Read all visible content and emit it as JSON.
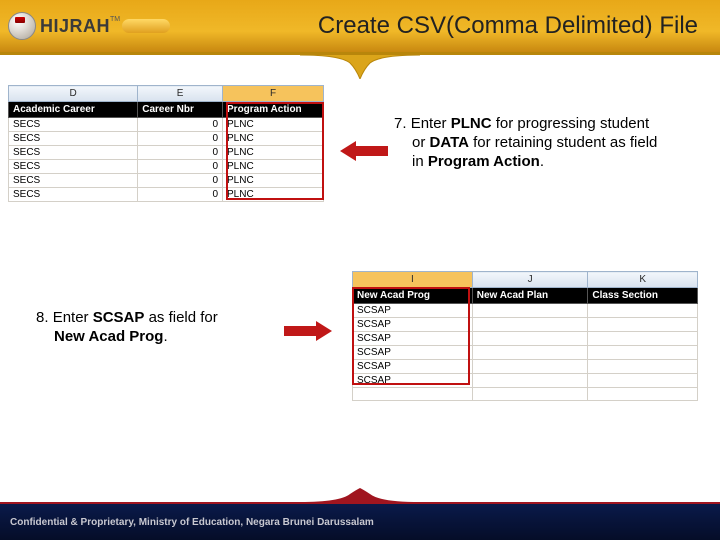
{
  "brand": {
    "name": "HIJRAH",
    "tm": "TM"
  },
  "title": "Create CSV(Comma Delimited) File",
  "table1": {
    "cols": {
      "d": "D",
      "e": "E",
      "f": "F"
    },
    "fields": {
      "career": "Academic Career",
      "nbr": "Career Nbr",
      "action": "Program Action"
    },
    "rows": [
      {
        "career": "SECS",
        "nbr": "0",
        "action": "PLNC"
      },
      {
        "career": "SECS",
        "nbr": "0",
        "action": "PLNC"
      },
      {
        "career": "SECS",
        "nbr": "0",
        "action": "PLNC"
      },
      {
        "career": "SECS",
        "nbr": "0",
        "action": "PLNC"
      },
      {
        "career": "SECS",
        "nbr": "0",
        "action": "PLNC"
      },
      {
        "career": "SECS",
        "nbr": "0",
        "action": "PLNC"
      }
    ]
  },
  "table2": {
    "cols": {
      "i": "I",
      "j": "J",
      "k": "K"
    },
    "fields": {
      "prog": "New Acad Prog",
      "plan": "New Acad Plan",
      "section": "Class Section"
    },
    "rows": [
      {
        "prog": "SCSAP",
        "plan": "",
        "section": ""
      },
      {
        "prog": "SCSAP",
        "plan": "",
        "section": ""
      },
      {
        "prog": "SCSAP",
        "plan": "",
        "section": ""
      },
      {
        "prog": "SCSAP",
        "plan": "",
        "section": ""
      },
      {
        "prog": "SCSAP",
        "plan": "",
        "section": ""
      },
      {
        "prog": "SCSAP",
        "plan": "",
        "section": ""
      }
    ]
  },
  "instr7": {
    "num": "7. ",
    "p1a": "Enter ",
    "p1b": "PLNC",
    "p1c": " for progressing student",
    "p2a": "or ",
    "p2b": "DATA",
    "p2c": " for retaining student as field",
    "p3a": "in ",
    "p3b": "Program Action",
    "p3c": "."
  },
  "instr8": {
    "num": "8. ",
    "p1a": "Enter ",
    "p1b": "SCSAP",
    "p1c": " as field for",
    "p2a": "",
    "p2b": "New Acad Prog",
    "p2c": "."
  },
  "footer": "Confidential & Proprietary, Ministry of Education, Negara Brunei Darussalam"
}
